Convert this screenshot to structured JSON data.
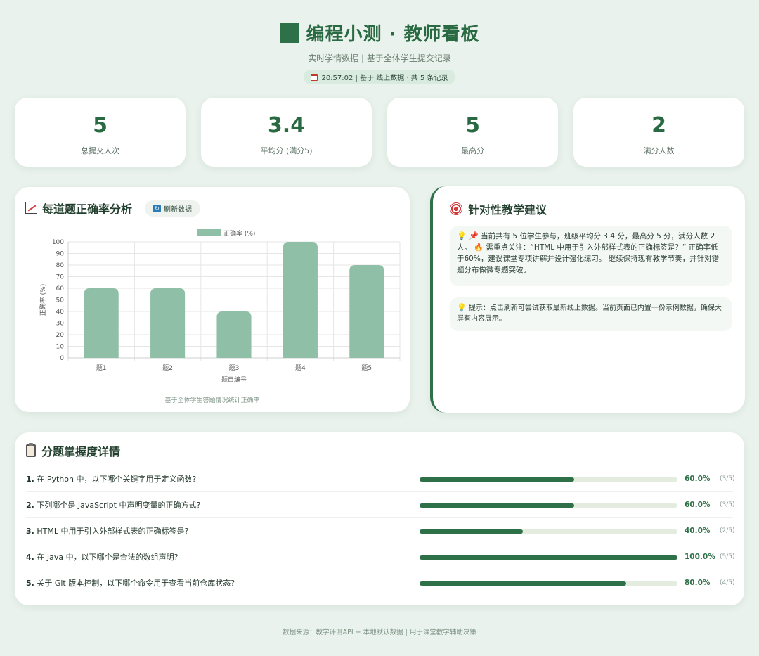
{
  "header": {
    "title": "编程小测 · 教师看板",
    "subtitle": "实时学情数据 | 基于全体学生提交记录",
    "status": "20:57:02 | 基于 线上数据 · 共 5 条记录"
  },
  "stats": [
    {
      "value": "5",
      "label": "总提交人次"
    },
    {
      "value": "3.4",
      "label": "平均分 (满分5)"
    },
    {
      "value": "5",
      "label": "最高分"
    },
    {
      "value": "2",
      "label": "满分人数"
    }
  ],
  "chart_panel": {
    "title": "每道题正确率分析",
    "refresh_label": "刷新数据",
    "note": "基于全体学生答题情况统计正确率"
  },
  "chart_data": {
    "type": "bar",
    "categories": [
      "题1",
      "题2",
      "题3",
      "题4",
      "题5"
    ],
    "series": [
      {
        "name": "正确率 (%)",
        "values": [
          60,
          60,
          40,
          100,
          80
        ]
      }
    ],
    "xlabel": "题目编号",
    "ylabel": "正确率 (%)",
    "ylim": [
      0,
      100
    ],
    "yticks": [
      0,
      10,
      20,
      30,
      40,
      50,
      60,
      70,
      80,
      90,
      100
    ],
    "grid": true,
    "legend": "top-center",
    "bar_color": "#8fbfa6"
  },
  "advice": {
    "title": "针对性教学建议",
    "main_text": "当前共有 5 位学生参与，班级平均分 3.4 分，最高分 5 分，满分人数 2 人。",
    "focus_text": "需重点关注：“HTML 中用于引入外部样式表的正确标签是？” 正确率低于60%，建议课堂专项讲解并设计强化练习。 继续保持现有教学节奏，并针对错题分布做微专题突破。",
    "tip_text": "提示：点击刷新可尝试获取最新线上数据。当前页面已内置一份示例数据，确保大屏有内容展示。"
  },
  "details": {
    "title": "分题掌握度详情",
    "questions": [
      {
        "num": "1.",
        "text": "在 Python 中，以下哪个关键字用于定义函数?",
        "rate": 60,
        "pct": "60.0%",
        "count": "(3/5)"
      },
      {
        "num": "2.",
        "text": "下列哪个是 JavaScript 中声明变量的正确方式?",
        "rate": 60,
        "pct": "60.0%",
        "count": "(3/5)"
      },
      {
        "num": "3.",
        "text": "HTML 中用于引入外部样式表的正确标签是?",
        "rate": 40,
        "pct": "40.0%",
        "count": "(2/5)"
      },
      {
        "num": "4.",
        "text": "在 Java 中，以下哪个是合法的数组声明?",
        "rate": 100,
        "pct": "100.0%",
        "count": "(5/5)"
      },
      {
        "num": "5.",
        "text": "关于 Git 版本控制，以下哪个命令用于查看当前仓库状态?",
        "rate": 80,
        "pct": "80.0%",
        "count": "(4/5)"
      }
    ]
  },
  "footer": "数据来源：教学评测API + 本地默认数据 | 用于课堂教学辅助决策",
  "colors": {
    "accent": "#2e7048",
    "bar": "#8fbfa6",
    "track": "#e3ecdf",
    "background": "#e9f2ec"
  }
}
